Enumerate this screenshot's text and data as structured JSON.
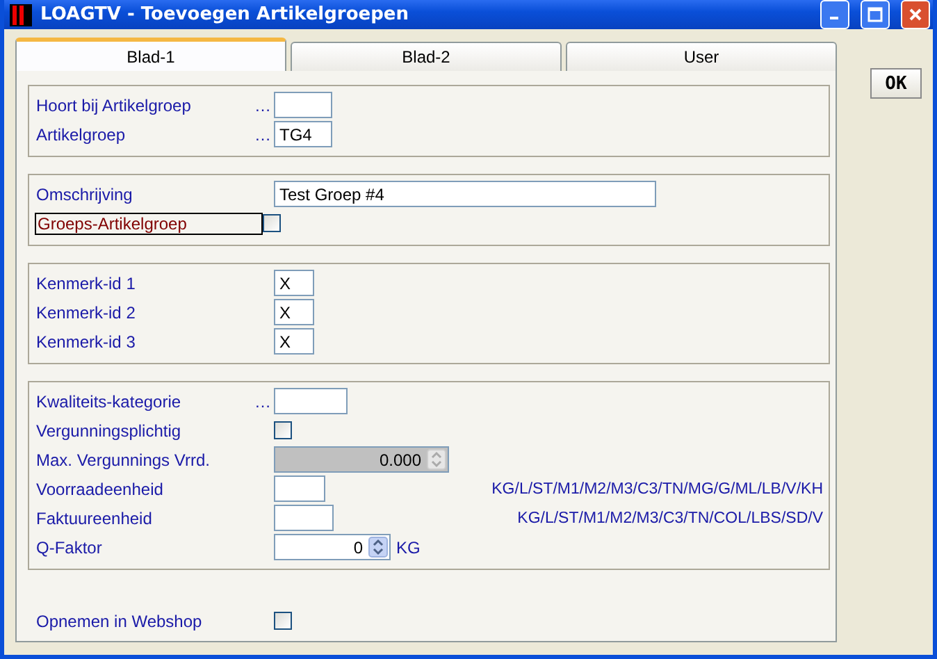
{
  "window": {
    "title": "LOAGTV - Toevoegen Artikelgroepen"
  },
  "tabs": [
    {
      "label": "Blad-1",
      "selected": true
    },
    {
      "label": "Blad-2",
      "selected": false
    },
    {
      "label": "User",
      "selected": false
    }
  ],
  "ok_button": "OK",
  "sections": [
    {
      "framed": true,
      "rows": [
        {
          "kind": "field",
          "label": "Hoort bij Artikelgroep",
          "lookup": "…",
          "highlighted": false
        },
        {
          "kind": "field",
          "label": "Artikelgroep",
          "lookup": "…",
          "value": "TG4",
          "highlighted": false
        }
      ]
    },
    {
      "framed": true,
      "rows": [
        {
          "kind": "field",
          "label": "Omschrijving",
          "value": "Test Groep #4",
          "highlighted": false
        },
        {
          "kind": "checkbox",
          "label": "Groeps-Artikelgroep",
          "checked": false,
          "highlighted": true
        }
      ]
    },
    {
      "framed": true,
      "rows": [
        {
          "kind": "field",
          "label": "Kenmerk-id 1",
          "value": "X",
          "highlighted": false
        },
        {
          "kind": "field",
          "label": "Kenmerk-id 2",
          "value": "X",
          "highlighted": false
        },
        {
          "kind": "field",
          "label": "Kenmerk-id 3",
          "value": "X",
          "highlighted": false
        }
      ]
    },
    {
      "framed": true,
      "rows": [
        {
          "kind": "field",
          "label": "Kwaliteits-kategorie",
          "lookup": "…",
          "highlighted": false
        },
        {
          "kind": "checkbox",
          "label": "Vergunningsplichtig",
          "checked": false,
          "highlighted": false
        },
        {
          "kind": "spinner",
          "label": "Max. Vergunnings Vrrd.",
          "value": "0.000",
          "disabled": true,
          "highlighted": false
        },
        {
          "kind": "field",
          "label": "Voorraadeenheid",
          "hint": "KG/L/ST/M1/M2/M3/C3/TN/MG/G/ML/LB/V/KH",
          "highlighted": false
        },
        {
          "kind": "field",
          "label": "Faktuureenheid",
          "hint": "KG/L/ST/M1/M2/M3/C3/TN/COL/LBS/SD/V",
          "highlighted": false
        },
        {
          "kind": "spinner",
          "label": "Q-Faktor",
          "value": "0",
          "unit": "KG",
          "disabled": false,
          "highlighted": false
        }
      ]
    },
    {
      "framed": false,
      "rows": [
        {
          "kind": "checkbox",
          "label": "Opnemen in Webshop",
          "checked": false,
          "highlighted": false
        }
      ]
    }
  ]
}
